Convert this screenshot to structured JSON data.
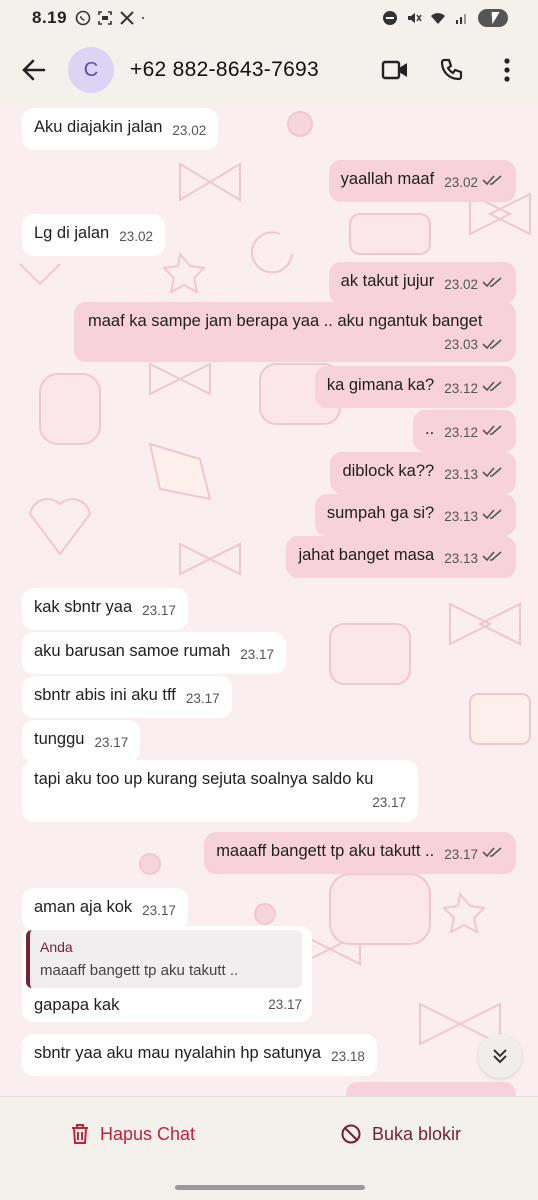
{
  "status_bar": {
    "time": "8.19"
  },
  "header": {
    "avatar_letter": "C",
    "contact": "+62 882-8643-7693"
  },
  "messages": [
    {
      "dir": "in",
      "text": "Aku diajakin jalan",
      "time": "23.02"
    },
    {
      "dir": "out",
      "text": "yaallah maaf",
      "time": "23.02"
    },
    {
      "dir": "in",
      "text": "Lg di jalan",
      "time": "23.02"
    },
    {
      "dir": "out",
      "text": "ak takut jujur",
      "time": "23.02"
    },
    {
      "dir": "out",
      "text": "maaf ka sampe jam berapa yaa .. aku ngantuk banget",
      "time": "23.03"
    },
    {
      "dir": "out",
      "text": "ka gimana ka?",
      "time": "23.12"
    },
    {
      "dir": "out",
      "text": "..",
      "time": "23.12"
    },
    {
      "dir": "out",
      "text": "diblock ka??",
      "time": "23.13"
    },
    {
      "dir": "out",
      "text": "sumpah ga si?",
      "time": "23.13"
    },
    {
      "dir": "out",
      "text": "jahat banget masa",
      "time": "23.13"
    },
    {
      "dir": "in",
      "text": "kak sbntr yaa",
      "time": "23.17"
    },
    {
      "dir": "in",
      "text": "aku barusan samoe rumah",
      "time": "23.17"
    },
    {
      "dir": "in",
      "text": "sbntr abis ini aku tff",
      "time": "23.17"
    },
    {
      "dir": "in",
      "text": "tunggu",
      "time": "23.17"
    },
    {
      "dir": "in",
      "text": "tapi aku too up kurang sejuta soalnya saldo ku",
      "time": "23.17"
    },
    {
      "dir": "out",
      "text": "maaaff bangett tp aku takutt ..",
      "time": "23.17"
    },
    {
      "dir": "in",
      "text": "aman aja kok",
      "time": "23.17"
    },
    {
      "dir": "in",
      "text": "gapapa kak",
      "time": "23.17",
      "quote_author": "Anda",
      "quote_text": "maaaff bangett tp aku takutt .."
    },
    {
      "dir": "in",
      "text": "sbntr yaa aku mau nyalahin hp satunya",
      "time": "23.18"
    }
  ],
  "bottom_bar": {
    "delete_label": "Hapus Chat",
    "unblock_label": "Buka blokir"
  },
  "colors": {
    "incoming": "#ffffff",
    "outgoing": "#f7d2dc",
    "delete": "#c4223c",
    "unblock": "#7a1c3a"
  }
}
